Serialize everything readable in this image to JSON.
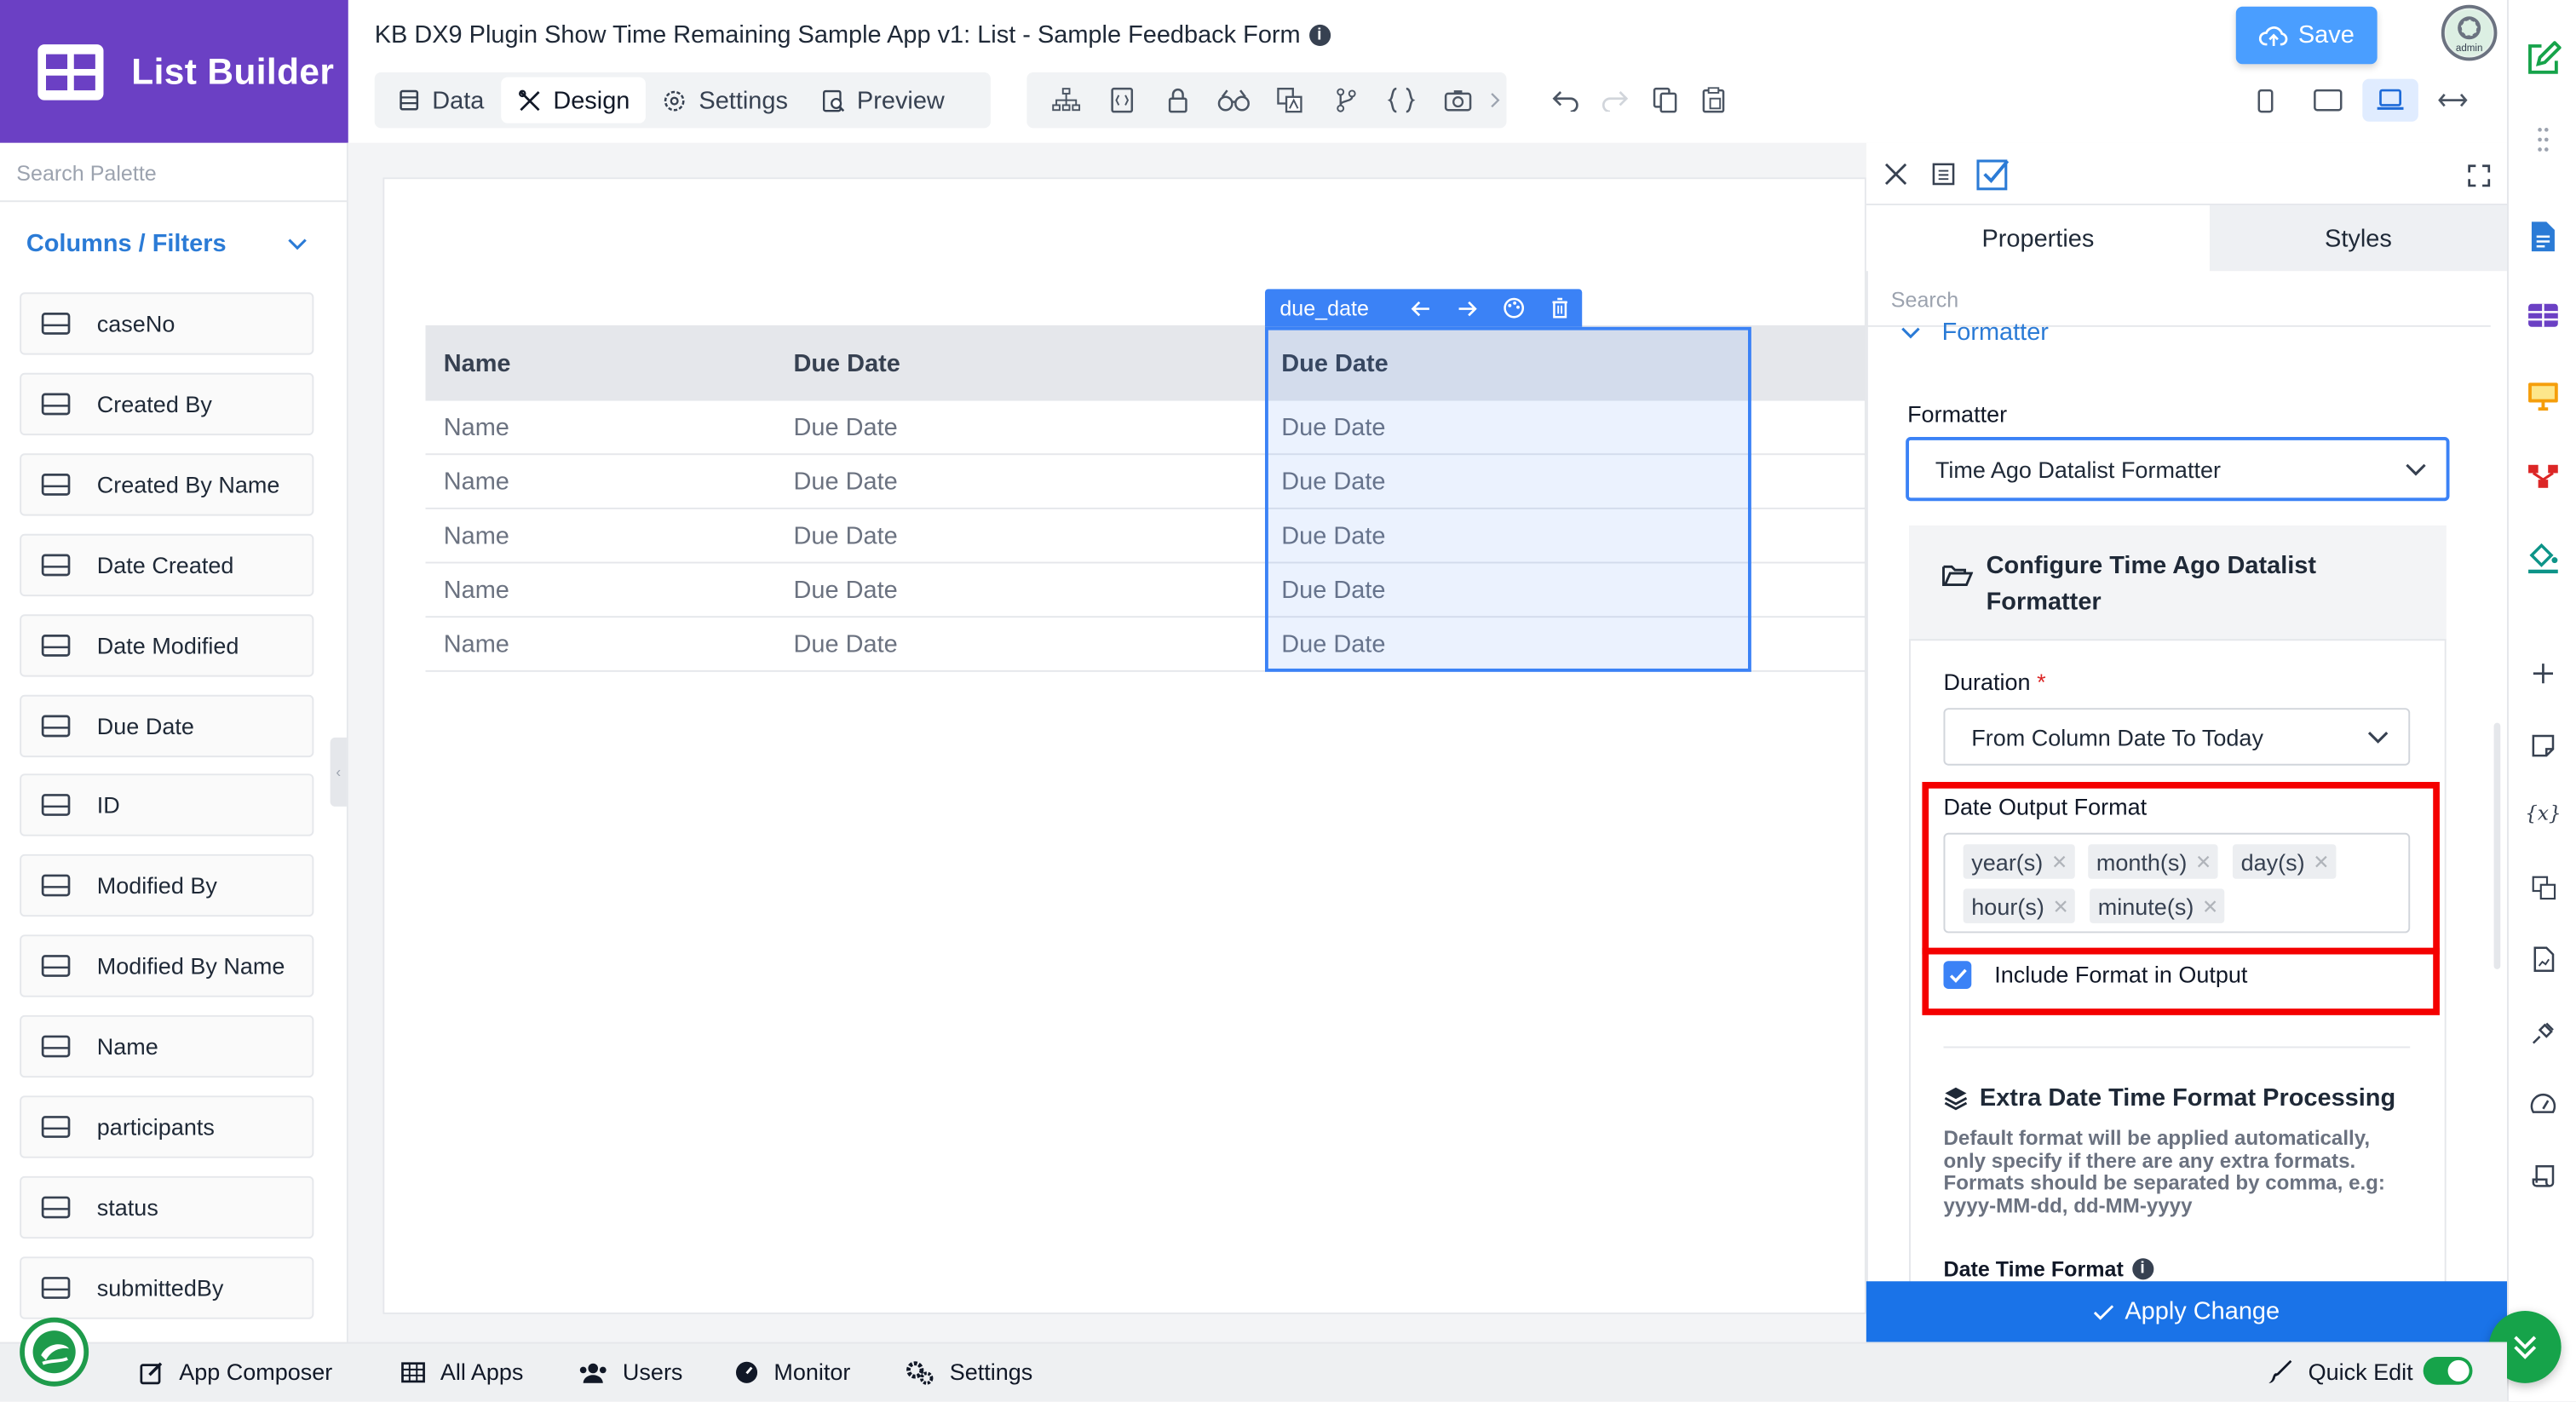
{
  "app": {
    "logo_title": "List Builder",
    "title": "KB DX9 Plugin Show Time Remaining Sample App v1: List - Sample Feedback Form",
    "save_label": "Save",
    "avatar_label": "admin"
  },
  "tabs": [
    {
      "label": "Data",
      "icon": "database-icon"
    },
    {
      "label": "Design",
      "icon": "design-tools-icon",
      "active": true
    },
    {
      "label": "Settings",
      "icon": "gear-icon"
    },
    {
      "label": "Preview",
      "icon": "preview-icon"
    }
  ],
  "palette": {
    "search_placeholder": "Search Palette",
    "section_title": "Columns / Filters",
    "items": [
      "caseNo",
      "Created By",
      "Created By Name",
      "Date Created",
      "Date Modified",
      "Due Date",
      "ID",
      "Modified By",
      "Modified By Name",
      "Name",
      "participants",
      "status",
      "submittedBy"
    ]
  },
  "table": {
    "columns": [
      "Name",
      "Due Date",
      "Due Date"
    ],
    "rows": [
      [
        "Name",
        "Due Date",
        "Due Date"
      ],
      [
        "Name",
        "Due Date",
        "Due Date"
      ],
      [
        "Name",
        "Due Date",
        "Due Date"
      ],
      [
        "Name",
        "Due Date",
        "Due Date"
      ],
      [
        "Name",
        "Due Date",
        "Due Date"
      ]
    ],
    "selected_column_id": "due_date"
  },
  "properties": {
    "tabs": [
      "Properties",
      "Styles"
    ],
    "search_placeholder": "Search",
    "section": "Formatter",
    "formatter_label": "Formatter",
    "formatter_value": "Time Ago Datalist Formatter",
    "config_title": "Configure Time Ago Datalist Formatter",
    "duration_label": "Duration",
    "duration_required": "*",
    "duration_value": "From Column Date To Today",
    "date_output_label": "Date Output Format",
    "date_output_chips": [
      "year(s)",
      "month(s)",
      "day(s)",
      "hour(s)",
      "minute(s)"
    ],
    "include_format_label": "Include Format in Output",
    "include_format_checked": true,
    "extra_title": "Extra Date Time Format Processing",
    "extra_desc": "Default format will be applied automatically, only specify if there are any extra formats. Formats should be separated by comma, e.g: yyyy-MM-dd, dd-MM-yyyy",
    "date_time_format_label": "Date Time Format",
    "apply_label": "Apply Change"
  },
  "bottom_bar": {
    "items": [
      "App Composer",
      "All Apps",
      "Users",
      "Monitor",
      "Settings"
    ],
    "quick_edit_label": "Quick Edit"
  },
  "colors": {
    "brand": "#6b40c4",
    "accent": "#3b82f6",
    "highlight": "#f40000",
    "green": "#16a34a"
  }
}
